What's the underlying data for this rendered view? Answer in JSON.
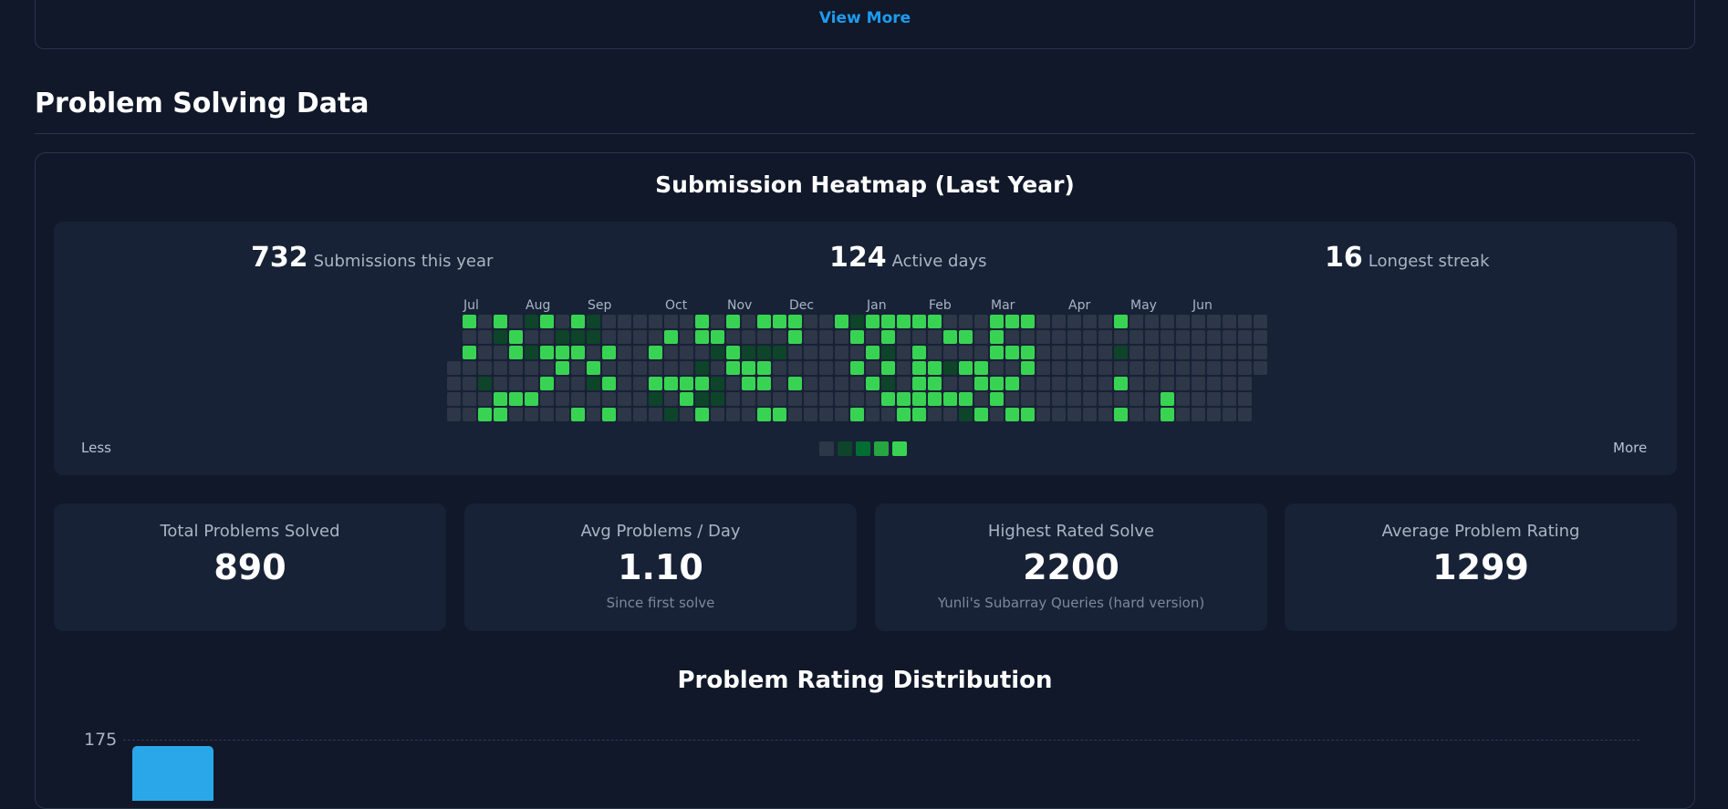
{
  "top_card": {
    "view_more_label": "View More"
  },
  "section": {
    "title": "Problem Solving Data"
  },
  "heatmap": {
    "title": "Submission Heatmap (Last Year)",
    "stats": [
      {
        "value": "732",
        "label": "Submissions this year"
      },
      {
        "value": "124",
        "label": "Active days"
      },
      {
        "value": "16",
        "label": "Longest streak"
      }
    ],
    "months": [
      "Jul",
      "Aug",
      "Sep",
      "Oct",
      "Nov",
      "Dec",
      "Jan",
      "Feb",
      "Mar",
      "Apr",
      "May",
      "Jun"
    ],
    "legend_less": "Less",
    "legend_more": "More",
    "colors": [
      "#2d3748",
      "#0e4429",
      "#006d32",
      "#26a641",
      "#39d353"
    ]
  },
  "metrics": [
    {
      "label": "Total Problems Solved",
      "value": "890",
      "sub": ""
    },
    {
      "label": "Avg Problems / Day",
      "value": "1.10",
      "sub": "Since first solve"
    },
    {
      "label": "Highest Rated Solve",
      "value": "2200",
      "sub": "Yunli's Subarray Queries (hard version)"
    },
    {
      "label": "Average Problem Rating",
      "value": "1299",
      "sub": ""
    }
  ],
  "chart_data": {
    "type": "bar",
    "title": "Problem Rating Distribution",
    "y_ticks": [
      "175"
    ],
    "visible_bars": 1,
    "bar_color": "#2aa7e8"
  }
}
